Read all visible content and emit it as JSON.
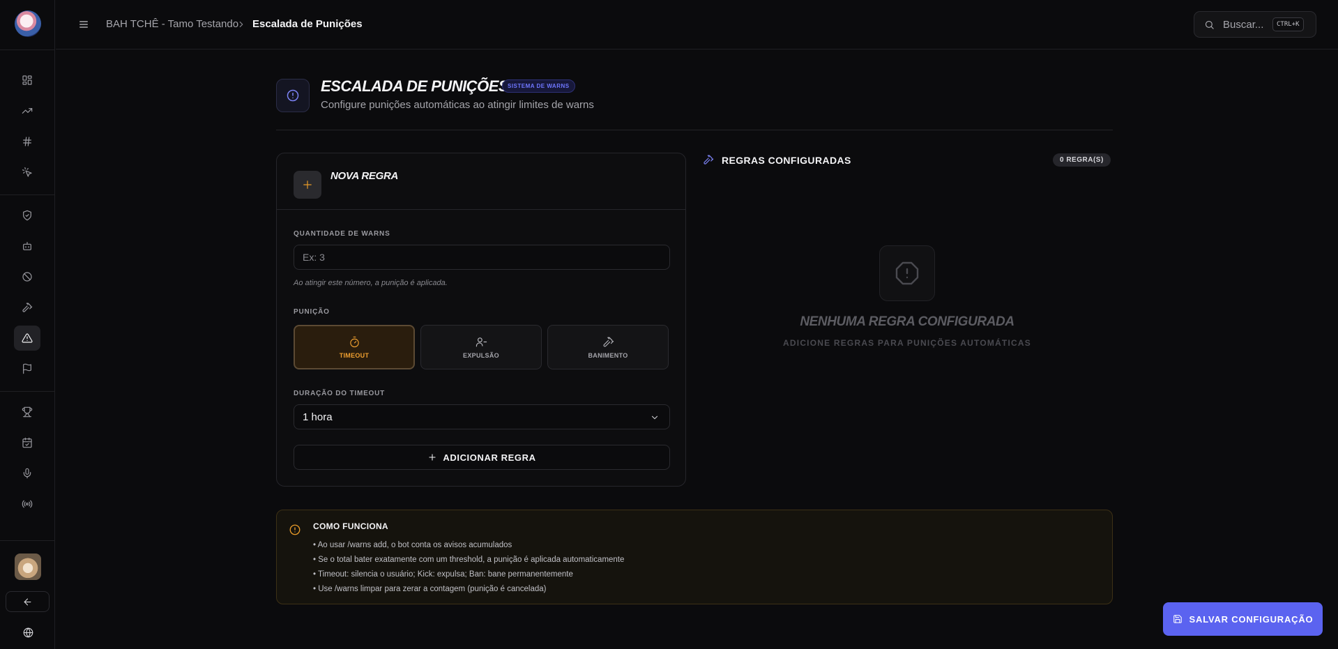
{
  "breadcrumb": {
    "server": "BAH TCHÊ - Tamo Testando",
    "current": "Escalada de Punições"
  },
  "search": {
    "placeholder": "Buscar...",
    "shortcut": "CTRL+K"
  },
  "sidebar": {
    "items": [
      {
        "icon": "dashboard-icon"
      },
      {
        "icon": "trending-up-icon"
      },
      {
        "icon": "hash-icon"
      },
      {
        "icon": "sparkle-icon"
      },
      {
        "icon": "shield-check-icon"
      },
      {
        "icon": "bot-icon"
      },
      {
        "icon": "ban-icon"
      },
      {
        "icon": "hammer-icon"
      },
      {
        "icon": "warning-triangle-icon",
        "active": true
      },
      {
        "icon": "flag-icon"
      },
      {
        "icon": "trophy-icon"
      },
      {
        "icon": "calendar-check-icon"
      },
      {
        "icon": "microphone-icon"
      },
      {
        "icon": "broadcast-icon"
      }
    ]
  },
  "header": {
    "title": "ESCALADA DE PUNIÇÕES",
    "badge": "SISTEMA DE WARNS",
    "subtitle": "Configure punições automáticas ao atingir limites de warns"
  },
  "form": {
    "title": "NOVA REGRA",
    "warns_label": "QUANTIDADE DE WARNS",
    "warns_placeholder": "Ex: 3",
    "warns_hint": "Ao atingir este número, a punição é aplicada.",
    "punishment_label": "PUNIÇÃO",
    "options": [
      {
        "label": "TIMEOUT",
        "icon": "timer-icon",
        "selected": true
      },
      {
        "label": "EXPULSÃO",
        "icon": "user-minus-icon",
        "selected": false
      },
      {
        "label": "BANIMENTO",
        "icon": "hammer-icon",
        "selected": false
      }
    ],
    "duration_label": "DURAÇÃO DO TIMEOUT",
    "duration_value": "1 hora",
    "add_button": "ADICIONAR REGRA"
  },
  "rules": {
    "title": "REGRAS CONFIGURADAS",
    "count": "0 REGRA(S)",
    "empty_title": "NENHUMA REGRA CONFIGURADA",
    "empty_subtitle": "ADICIONE REGRAS PARA PUNIÇÕES AUTOMÁTICAS"
  },
  "info": {
    "title": "COMO FUNCIONA",
    "items": [
      "• Ao usar /warns add, o bot conta os avisos acumulados",
      "• Se o total bater exatamente com um threshold, a punição é aplicada automaticamente",
      "• Timeout: silencia o usuário; Kick: expulsa; Ban: bane permanentemente",
      "• Use /warns limpar para zerar a contagem (punição é cancelada)"
    ]
  },
  "save_button": "SALVAR CONFIGURAÇÃO",
  "colors": {
    "accent": "#5b63f0",
    "warning": "#e79a28",
    "background": "#0b0b0d"
  }
}
